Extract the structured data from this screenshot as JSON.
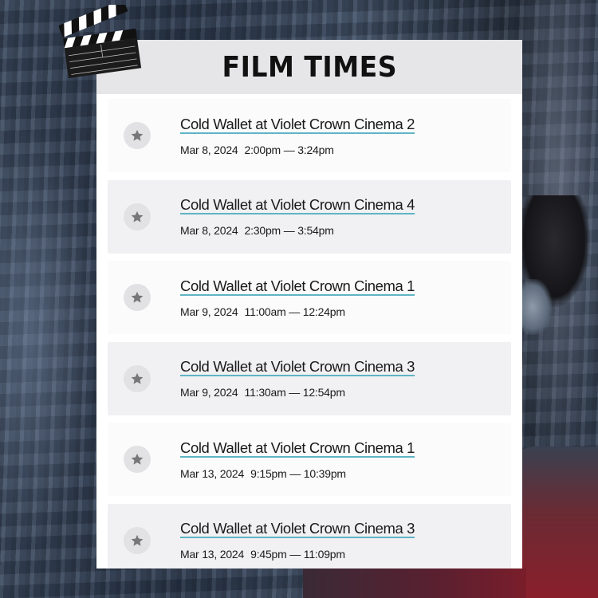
{
  "title": "FILM TIMES",
  "icons": {
    "clapperboard": "clapperboard-icon",
    "favorite": "star-icon"
  },
  "colors": {
    "panel": "#ffffff",
    "header": "#e6e6e8",
    "star_circle": "#e2e2e4",
    "star": "#777777",
    "link_underline": "#5fb4c4"
  },
  "showtimes": [
    {
      "title": "Cold Wallet at Violet Crown Cinema 2",
      "date": "Mar 8, 2024",
      "time": "2:00pm — 3:24pm"
    },
    {
      "title": "Cold Wallet at Violet Crown Cinema 4",
      "date": "Mar 8, 2024",
      "time": "2:30pm — 3:54pm"
    },
    {
      "title": "Cold Wallet at Violet Crown Cinema 1",
      "date": "Mar 9, 2024",
      "time": "11:00am — 12:24pm"
    },
    {
      "title": "Cold Wallet at Violet Crown Cinema 3",
      "date": "Mar 9, 2024",
      "time": "11:30am — 12:54pm"
    },
    {
      "title": "Cold Wallet at Violet Crown Cinema 1",
      "date": "Mar 13, 2024",
      "time": "9:15pm — 10:39pm"
    },
    {
      "title": "Cold Wallet at Violet Crown Cinema 3",
      "date": "Mar 13, 2024",
      "time": "9:45pm — 11:09pm"
    }
  ]
}
